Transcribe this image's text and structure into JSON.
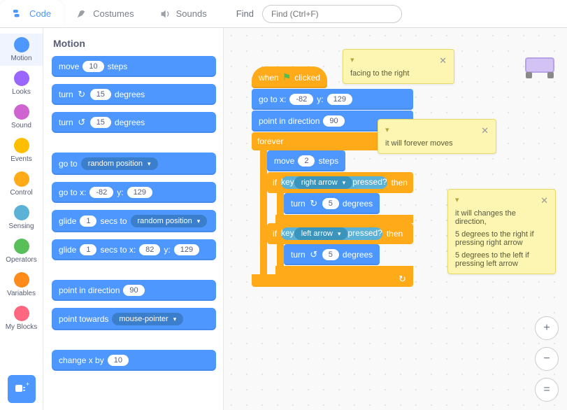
{
  "tabs": {
    "code": "Code",
    "costumes": "Costumes",
    "sounds": "Sounds"
  },
  "find": {
    "label": "Find",
    "placeholder": "Find (Ctrl+F)"
  },
  "categories": [
    {
      "label": "Motion",
      "color": "#4d97ff"
    },
    {
      "label": "Looks",
      "color": "#9966ff"
    },
    {
      "label": "Sound",
      "color": "#cf63cf"
    },
    {
      "label": "Events",
      "color": "#ffbf00"
    },
    {
      "label": "Control",
      "color": "#ffab19"
    },
    {
      "label": "Sensing",
      "color": "#5cb1d6"
    },
    {
      "label": "Operators",
      "color": "#59c059"
    },
    {
      "label": "Variables",
      "color": "#ff8c1a"
    },
    {
      "label": "My Blocks",
      "color": "#ff6680"
    }
  ],
  "palette": {
    "heading": "Motion",
    "move_a": "move",
    "move_b": "steps",
    "move_v": "10",
    "turn_a": "turn",
    "turn_b": "degrees",
    "turncw_v": "15",
    "turnccw_v": "15",
    "goto_a": "go to",
    "goto_drop": "random position",
    "gotoxy_a": "go to x:",
    "gotoxy_b": "y:",
    "gotoxy_x": "-82",
    "gotoxy_y": "129",
    "glide_a": "glide",
    "glide_b": "secs to",
    "glide_v": "1",
    "glide_drop": "random position",
    "glidexy_a": "glide",
    "glidexy_b": "secs to x:",
    "glidexy_c": "y:",
    "glidexy_s": "1",
    "glidexy_x": "82",
    "glidexy_y": "129",
    "pointdir_a": "point in direction",
    "pointdir_v": "90",
    "pointto_a": "point towards",
    "pointto_drop": "mouse-pointer",
    "changex_a": "change x by",
    "changex_v": "10"
  },
  "script": {
    "hat_a": "when",
    "hat_b": "clicked",
    "gotoxy_a": "go to x:",
    "gotoxy_b": "y:",
    "gotoxy_x": "-82",
    "gotoxy_y": "129",
    "pointdir_a": "point in direction",
    "pointdir_v": "90",
    "forever": "forever",
    "move_a": "move",
    "move_b": "steps",
    "move_v": "2",
    "if": "if",
    "then": "then",
    "key_a": "key",
    "key_b": "pressed?",
    "key_right": "right arrow",
    "key_left": "left arrow",
    "turn_a": "turn",
    "turn_b": "degrees",
    "turn_v": "5",
    "loop_icon": "↻"
  },
  "comments": {
    "c1": "facing to the right",
    "c2": "it will forever moves",
    "c3a": "it will changes the direction,",
    "c3b": "5 degrees to the right if pressing right arrow",
    "c3c": "5 degrees to the left if pressing left arrow"
  },
  "icons": {
    "cw": "↻",
    "ccw": "↺",
    "flag": "⚑",
    "zoomin": "+",
    "zoomout": "−",
    "center": "="
  }
}
